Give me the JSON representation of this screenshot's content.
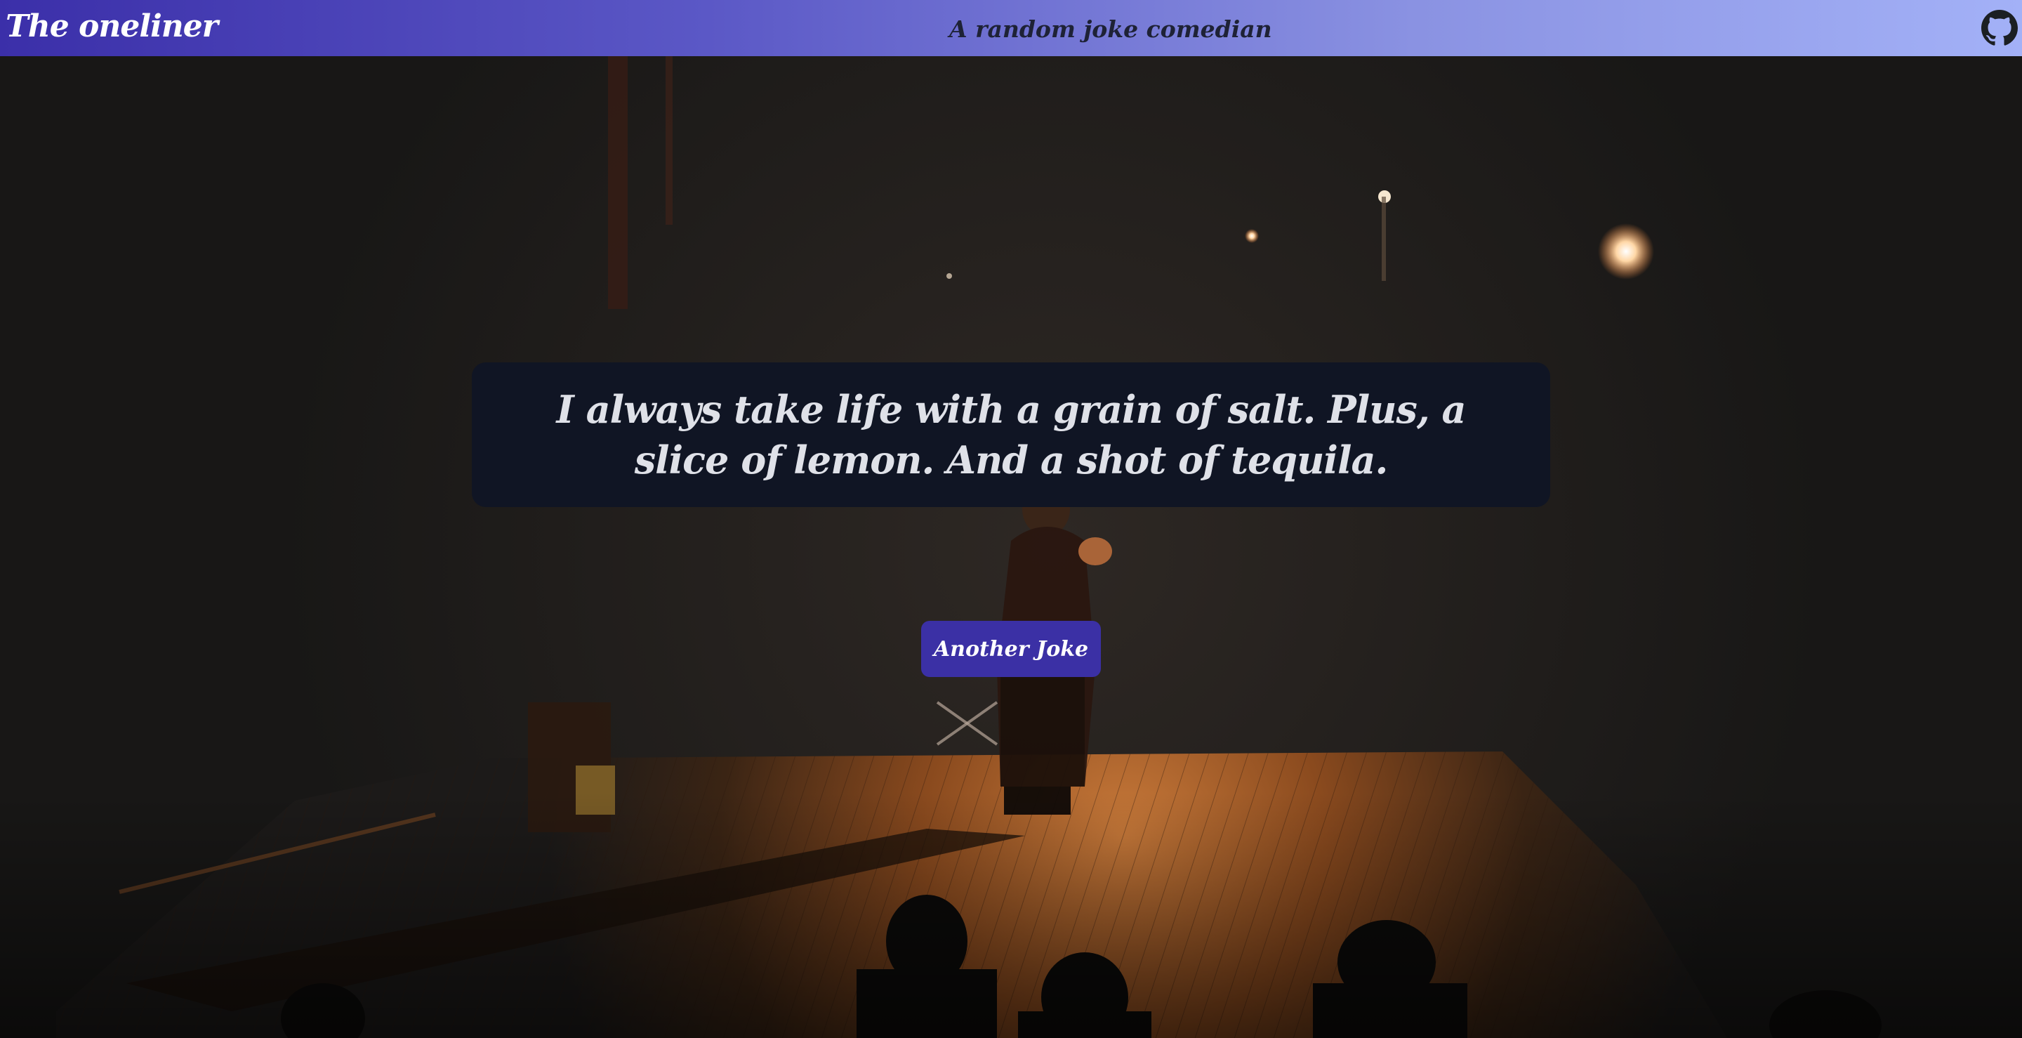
{
  "header": {
    "brand": "The oneliner",
    "tagline": "A random joke comedian",
    "github_icon": "github-icon"
  },
  "joke": {
    "text": "I always take life with a grain of salt. Plus, a slice of lemon. And a shot of tequila."
  },
  "actions": {
    "another_joke_label": "Another Joke"
  },
  "background": {
    "scene": "stage-photo"
  },
  "colors": {
    "header_gradient_start": "#3b2fa9",
    "header_gradient_end": "#a3b1f7",
    "joke_box_bg": "#101524",
    "joke_text": "#dfe1e8",
    "button_bg": "#3b30a5",
    "button_text": "#ffffff"
  }
}
